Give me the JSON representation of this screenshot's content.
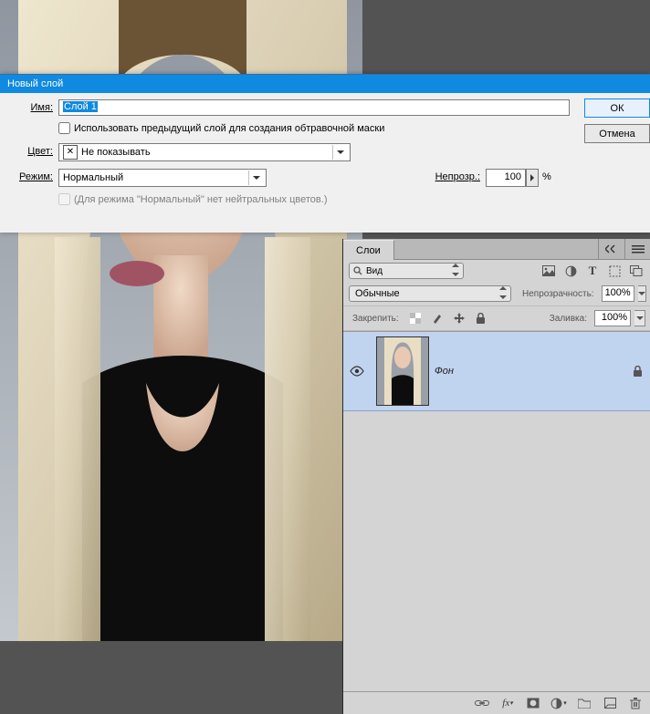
{
  "dialog": {
    "title": "Новый слой",
    "name_label": "Имя:",
    "name_value": "Слой 1",
    "clip_label": "Использовать предыдущий слой для создания обтравочной маски",
    "color_label": "Цвет:",
    "color_value": "Не показывать",
    "mode_label": "Режим:",
    "mode_value": "Нормальный",
    "opacity_label": "Непрозр.:",
    "opacity_value": "100",
    "opacity_unit": "%",
    "neutral_label": "(Для режима \"Нормальный\" нет нейтральных цветов.)",
    "ok": "ОК",
    "cancel": "Отмена"
  },
  "panel": {
    "tab": "Слои",
    "kind": "Вид",
    "blend": "Обычные",
    "opacity_label": "Непрозрачность:",
    "opacity_value": "100%",
    "lock_label": "Закрепить:",
    "fill_label": "Заливка:",
    "fill_value": "100%",
    "layer0": {
      "name": "Фон"
    }
  }
}
